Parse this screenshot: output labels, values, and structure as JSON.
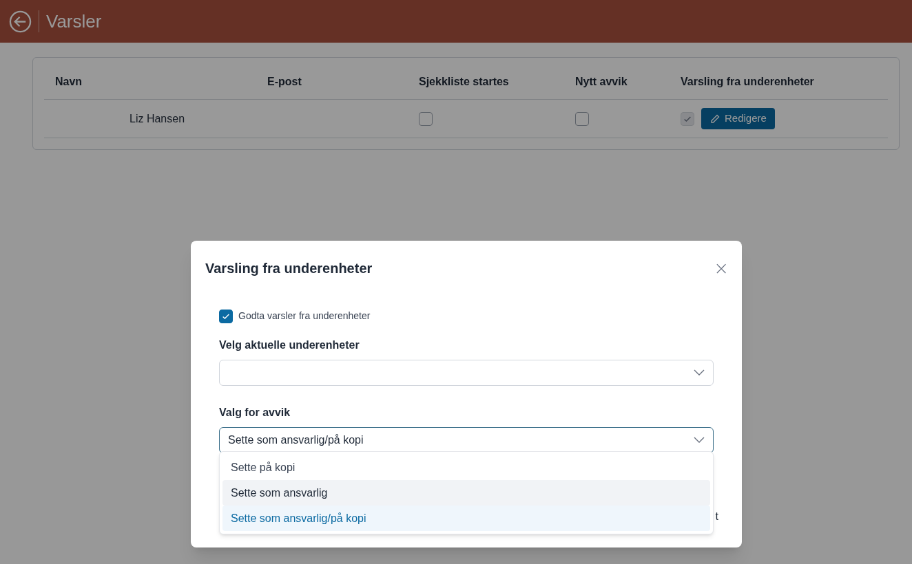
{
  "header": {
    "title": "Varsler"
  },
  "table": {
    "columns": [
      "Navn",
      "E-post",
      "Sjekkliste startes",
      "Nytt avvik",
      "Varsling fra underenheter"
    ],
    "rows": [
      {
        "name": "Liz Hansen",
        "checklist_started": false,
        "new_deviation": false,
        "subunit_alerts": true,
        "edit_button": "Redigere"
      }
    ]
  },
  "modal": {
    "title": "Varsling fra underenheter",
    "close": "×",
    "accept_checkbox": {
      "label": "Godta varsler fra underenheter",
      "checked": true
    },
    "subunits": {
      "label": "Velg aktuelle underenheter"
    },
    "deviation_choice": {
      "label": "Valg for avvik",
      "value": "Sette som ansvarlig/på kopi",
      "expanded": true,
      "options": [
        {
          "label": "Sette på kopi",
          "selected": false,
          "highlighted": false
        },
        {
          "label": "Sette som ansvarlig",
          "selected": false,
          "highlighted": true
        },
        {
          "label": "Sette som ansvarlig/på kopi",
          "selected": true,
          "highlighted": false
        }
      ]
    },
    "footer_fragment": "t"
  }
}
